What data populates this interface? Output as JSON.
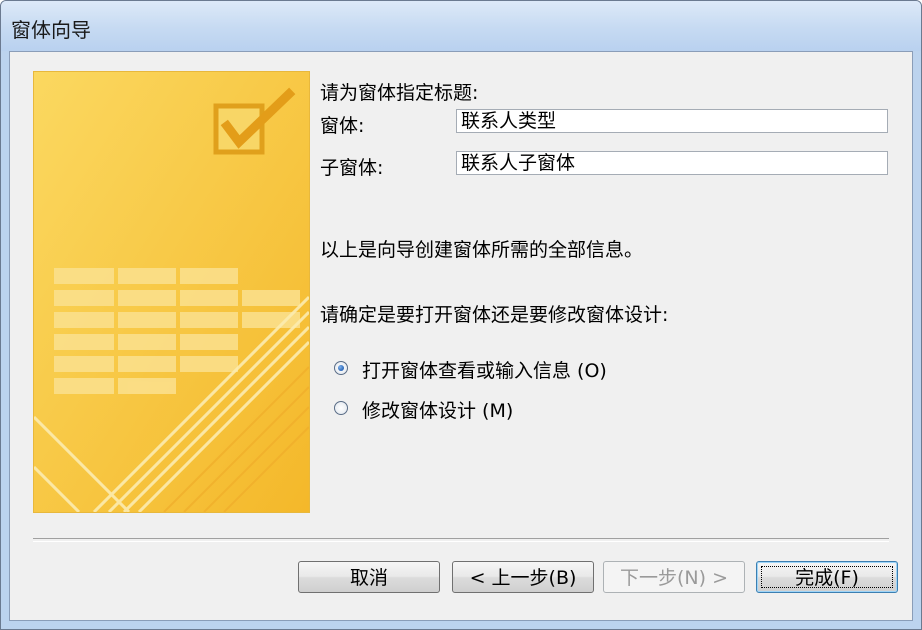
{
  "window": {
    "title": "窗体向导"
  },
  "form": {
    "prompt": "请为窗体指定标题:",
    "form_label": "窗体:",
    "form_value": "联系人类型",
    "subform_label": "子窗体:",
    "subform_value": "联系人子窗体"
  },
  "info": {
    "summary": "以上是向导创建窗体所需的全部信息。",
    "question": "请确定是要打开窗体还是要修改窗体设计:"
  },
  "options": [
    {
      "label": "打开窗体查看或输入信息 (O)",
      "checked": true
    },
    {
      "label": "修改窗体设计 (M)",
      "checked": false
    }
  ],
  "buttons": {
    "cancel": "取消",
    "back": "< 上一步(B)",
    "next": "下一步(N) >",
    "finish": "完成(F)"
  },
  "colors": {
    "wizard_image": "#f7c735",
    "title_bar": "#c6daf2",
    "dialog_background": "#f0f0f0"
  }
}
